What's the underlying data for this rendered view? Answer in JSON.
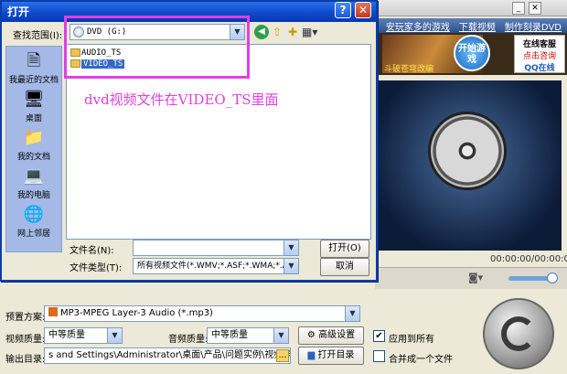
{
  "dialog": {
    "title": "打开",
    "help_glyph": "?",
    "close_glyph": "✕",
    "look_in_label": "查找范围(I):",
    "look_in_value": "DVD (G:)",
    "places": [
      {
        "label": "我最近的文档",
        "icon": "recent-documents-icon"
      },
      {
        "label": "桌面",
        "icon": "desktop-icon"
      },
      {
        "label": "我的文档",
        "icon": "my-documents-icon"
      },
      {
        "label": "我的电脑",
        "icon": "my-computer-icon"
      },
      {
        "label": "网上邻居",
        "icon": "network-places-icon"
      }
    ],
    "files": [
      {
        "name": "AUDIO_TS",
        "selected": false
      },
      {
        "name": "VIDEO_TS",
        "selected": true
      }
    ],
    "annotation": "dvd视频文件在VIDEO_TS里面",
    "file_name_label": "文件名(N):",
    "file_name_value": "",
    "file_type_label": "文件类型(T):",
    "file_type_value": "所有视频文件(*.WMV;*.ASF;*.WMA;*.AVI;",
    "open_label": "打开(O)",
    "cancel_label": "取消"
  },
  "app": {
    "links": [
      "安玩家多的游戏",
      "下载视频",
      "制作刻录DVD"
    ],
    "ad": {
      "start_label": "开始游戏",
      "title": "斗破苍穹改编",
      "service": "在线客服",
      "service_sub": "点击咨询",
      "qq": "QQ在线"
    },
    "time_readout": "00:00:00/00:00:00",
    "preset_label": "预置方案:",
    "preset_value": "MP3-MPEG Layer-3 Audio (*.mp3)",
    "video_quality_label": "视频质量:",
    "video_quality_value": "中等质量",
    "audio_quality_label": "音频质量:",
    "audio_quality_value": "中等质量",
    "advanced_label": "高级设置",
    "apply_all_label": "应用到所有",
    "apply_all_checked": true,
    "output_label": "输出目录:",
    "output_value": "s and Settings\\Administrator\\桌面\\产品\\问题实例\\视频原件\\转换",
    "open_dir_label": "打开目录",
    "merge_label": "合并成一个文件",
    "merge_checked": false
  }
}
